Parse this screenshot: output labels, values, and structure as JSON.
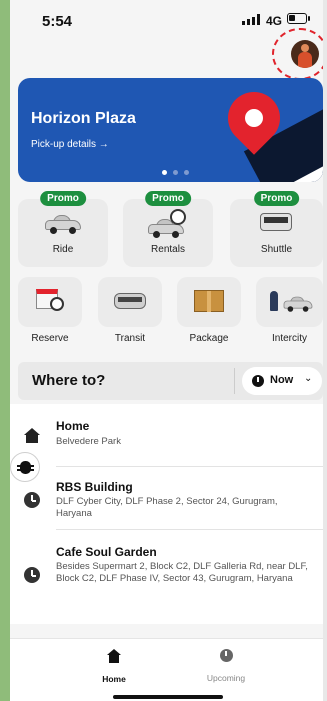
{
  "status_bar": {
    "time": "5:54",
    "network": "4G"
  },
  "banner": {
    "title": "Horizon Plaza",
    "link": "Pick-up details →"
  },
  "services_row1": [
    {
      "label": "Ride",
      "badge": "Promo"
    },
    {
      "label": "Rentals",
      "badge": "Promo"
    },
    {
      "label": "Shuttle",
      "badge": "Promo"
    }
  ],
  "services_row2": [
    {
      "label": "Reserve"
    },
    {
      "label": "Transit"
    },
    {
      "label": "Package"
    },
    {
      "label": "Intercity"
    }
  ],
  "where_to": {
    "label": "Where to?",
    "now_label": "Now",
    "chevron": "⌄"
  },
  "places": [
    {
      "title": "Home",
      "subtitle": "Belvedere Park",
      "icon": "home-icon"
    },
    {
      "title": "RBS Building",
      "subtitle": "DLF Cyber City, DLF Phase 2, Sector 24, Gurugram, Haryana",
      "icon": "recent-clock-icon"
    },
    {
      "title": "Cafe Soul Garden",
      "subtitle": "Besides Supermart 2, Block C2, DLF Galleria Rd, near DLF, Block C2, DLF Phase IV, Sector 43, Gurugram, Haryana",
      "icon": "recent-clock-icon"
    }
  ],
  "bottom_nav": {
    "home": "Home",
    "upcoming": "Upcoming"
  },
  "colors": {
    "banner_blue": "#1f57b3",
    "promo_green": "#1d8f3f",
    "pin_red": "#e3232d"
  }
}
